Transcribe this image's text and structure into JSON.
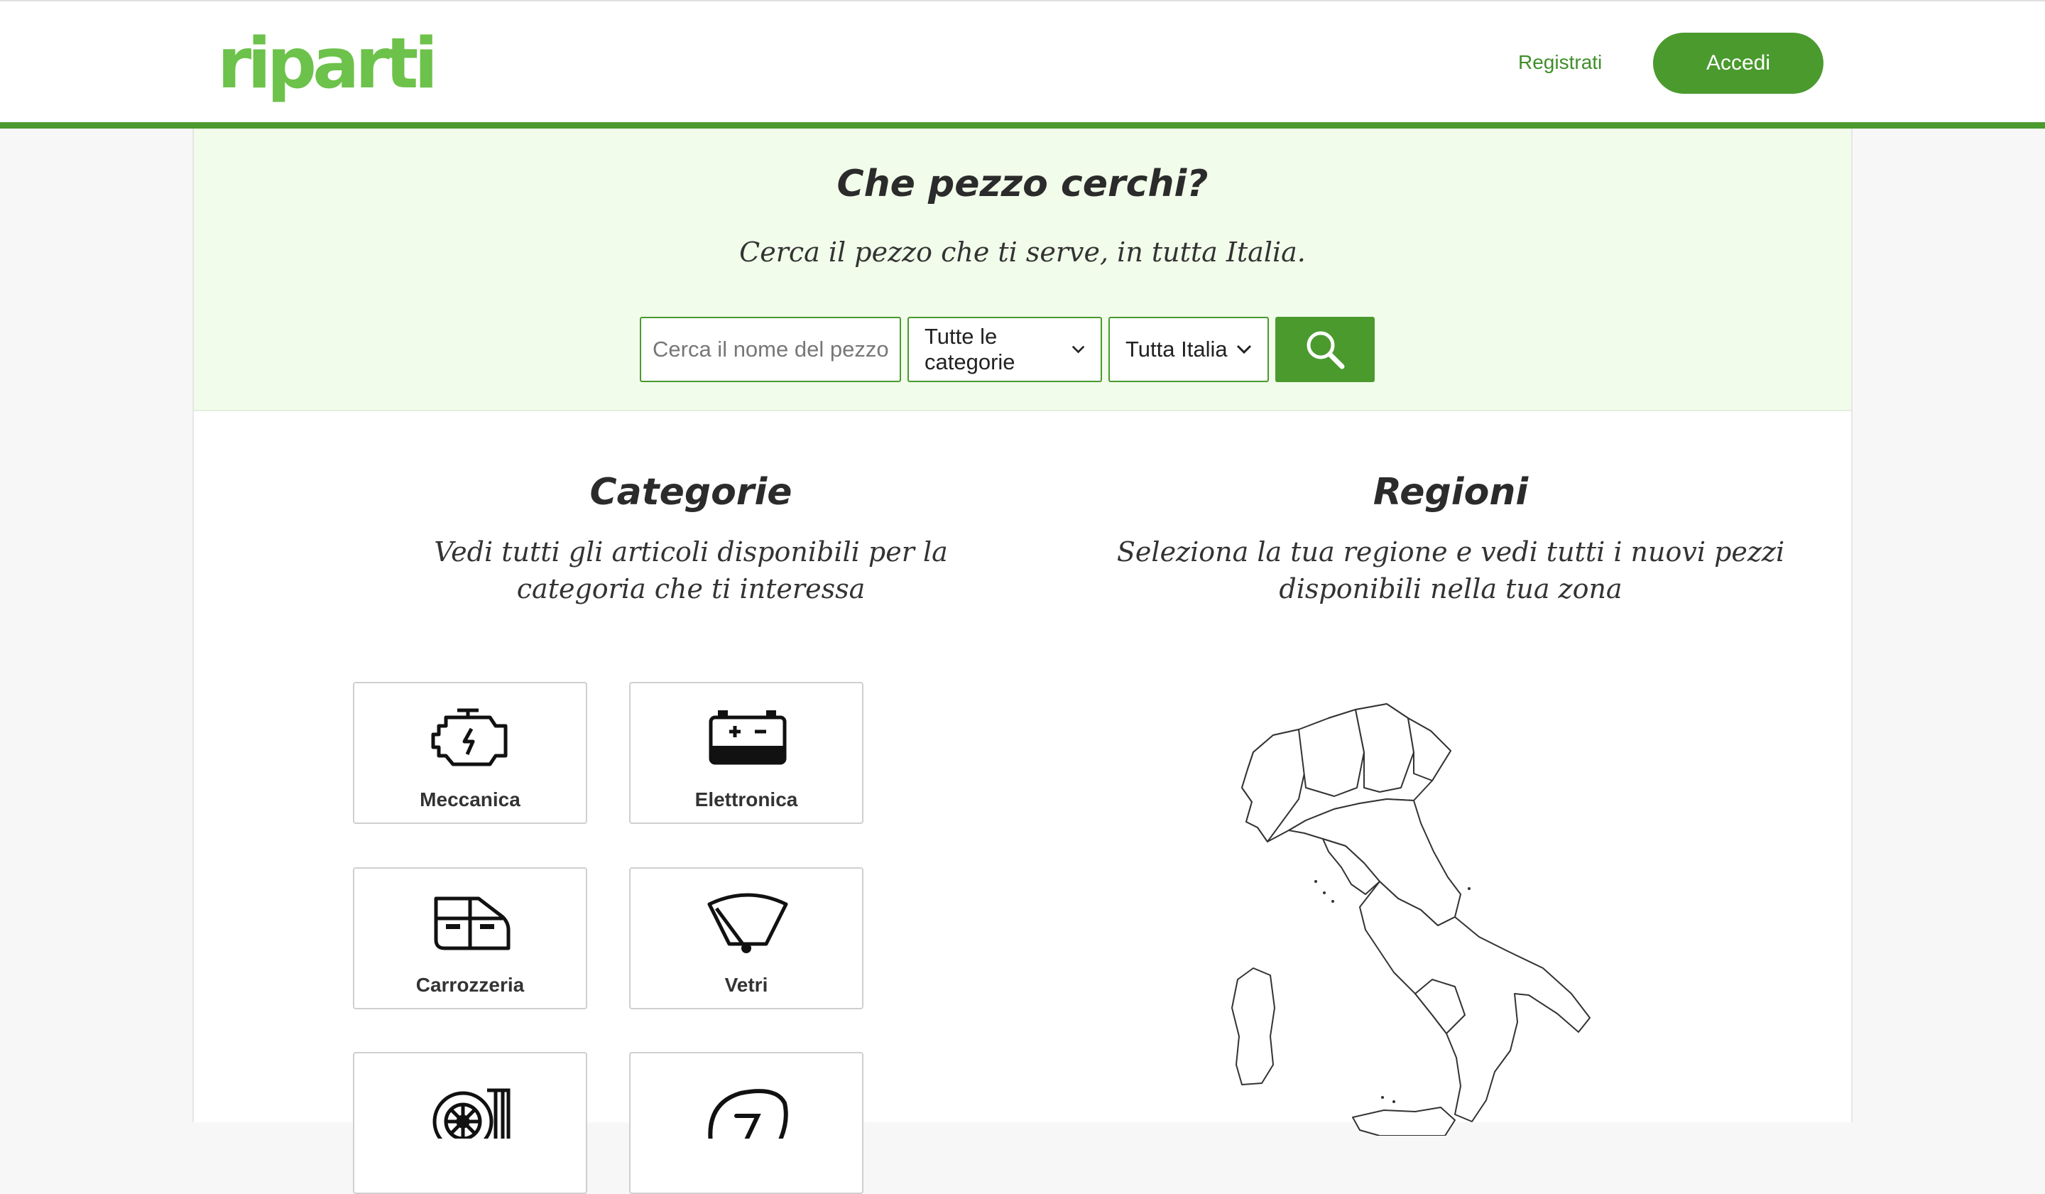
{
  "header": {
    "logo": "riparti",
    "register_label": "Registrati",
    "login_label": "Accedi"
  },
  "hero": {
    "title": "Che pezzo cerchi?",
    "subtitle": "Cerca il pezzo che ti serve, in tutta Italia.",
    "search_placeholder": "Cerca il nome del pezzo",
    "category_selected": "Tutte le categorie",
    "region_selected": "Tutta Italia"
  },
  "categories": {
    "title": "Categorie",
    "description_line1": "Vedi tutti gli articoli disponibili per la",
    "description_line2": "categoria che ti interessa",
    "items": [
      {
        "label": "Meccanica",
        "icon": "engine-icon"
      },
      {
        "label": "Elettronica",
        "icon": "battery-icon"
      },
      {
        "label": "Carrozzeria",
        "icon": "car-door-icon"
      },
      {
        "label": "Vetri",
        "icon": "windshield-wiper-icon"
      },
      {
        "label": "",
        "icon": "wheel-icon"
      },
      {
        "label": "",
        "icon": "seat-icon"
      }
    ]
  },
  "regions": {
    "title": "Regioni",
    "description_line1": "Seleziona la tua regione e vedi tutti i nuovi pezzi",
    "description_line2": "disponibili nella tua zona"
  },
  "colors": {
    "brand_green": "#4a9a2e",
    "logo_green": "#6cc24a",
    "hero_bg": "#f1fcea"
  }
}
